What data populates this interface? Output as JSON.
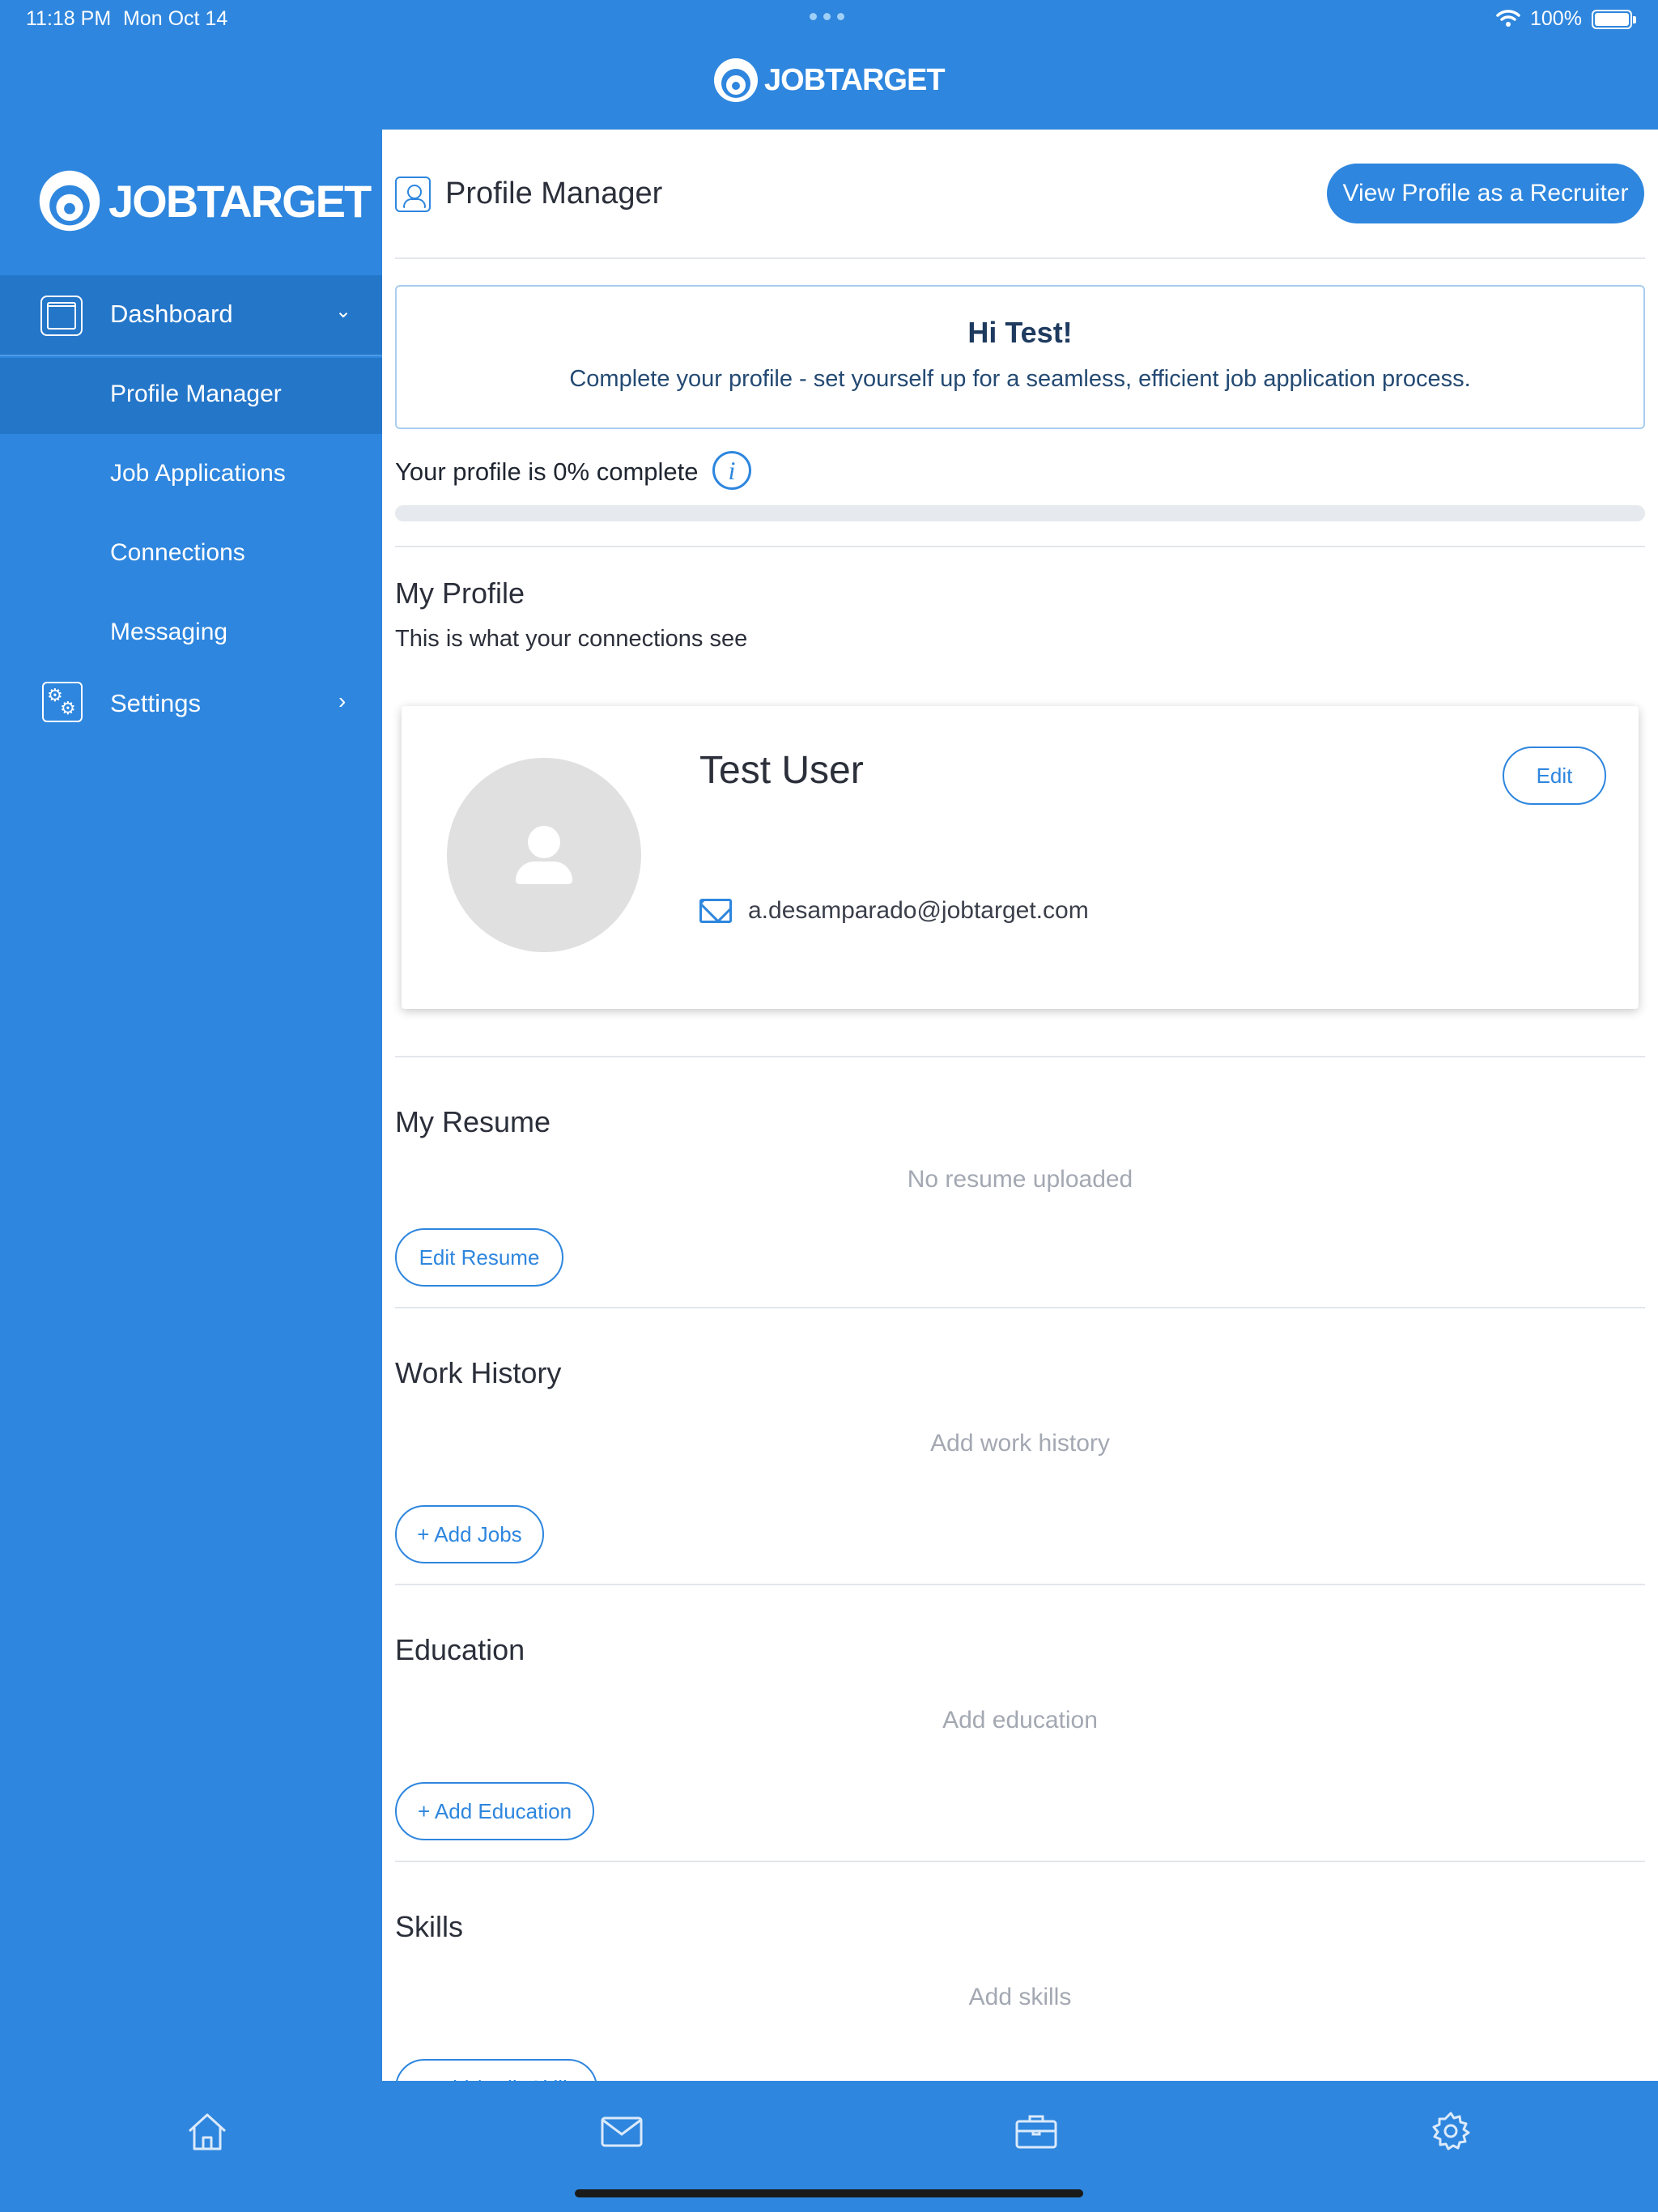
{
  "status_bar": {
    "time": "11:18 PM",
    "date": "Mon Oct 14",
    "battery": "100%"
  },
  "brand": {
    "name": "JOBTARGET"
  },
  "sidebar": {
    "dashboard_label": "Dashboard",
    "items": [
      {
        "label": "Profile Manager",
        "active": true
      },
      {
        "label": "Job Applications",
        "active": false
      },
      {
        "label": "Connections",
        "active": false
      },
      {
        "label": "Messaging",
        "active": false
      }
    ],
    "settings_label": "Settings"
  },
  "header": {
    "title": "Profile Manager",
    "recruiter_button": "View Profile as a Recruiter"
  },
  "welcome": {
    "greeting": "Hi Test!",
    "message": "Complete your profile - set yourself up for a seamless, efficient job application process."
  },
  "completion": {
    "text": "Your profile is 0% complete",
    "percent": 0
  },
  "my_profile": {
    "title": "My Profile",
    "subtitle": "This is what your connections see",
    "name": "Test User",
    "edit_label": "Edit",
    "email": "a.desamparado@jobtarget.com"
  },
  "resume": {
    "title": "My Resume",
    "empty_text": "No resume uploaded",
    "button": "Edit Resume"
  },
  "work_history": {
    "title": "Work History",
    "empty_text": "Add work history",
    "button": "+ Add Jobs"
  },
  "education": {
    "title": "Education",
    "empty_text": "Add education",
    "button": "+ Add Education"
  },
  "skills": {
    "title": "Skills",
    "empty_text": "Add skills",
    "button": "+ Add / Edit Skills"
  },
  "tabbar": [
    "home-icon",
    "mail-icon",
    "briefcase-icon",
    "gear-icon"
  ],
  "colors": {
    "primary": "#2E86DE",
    "sidebar_active": "#2476C9",
    "muted_text": "#a3a8b2"
  }
}
